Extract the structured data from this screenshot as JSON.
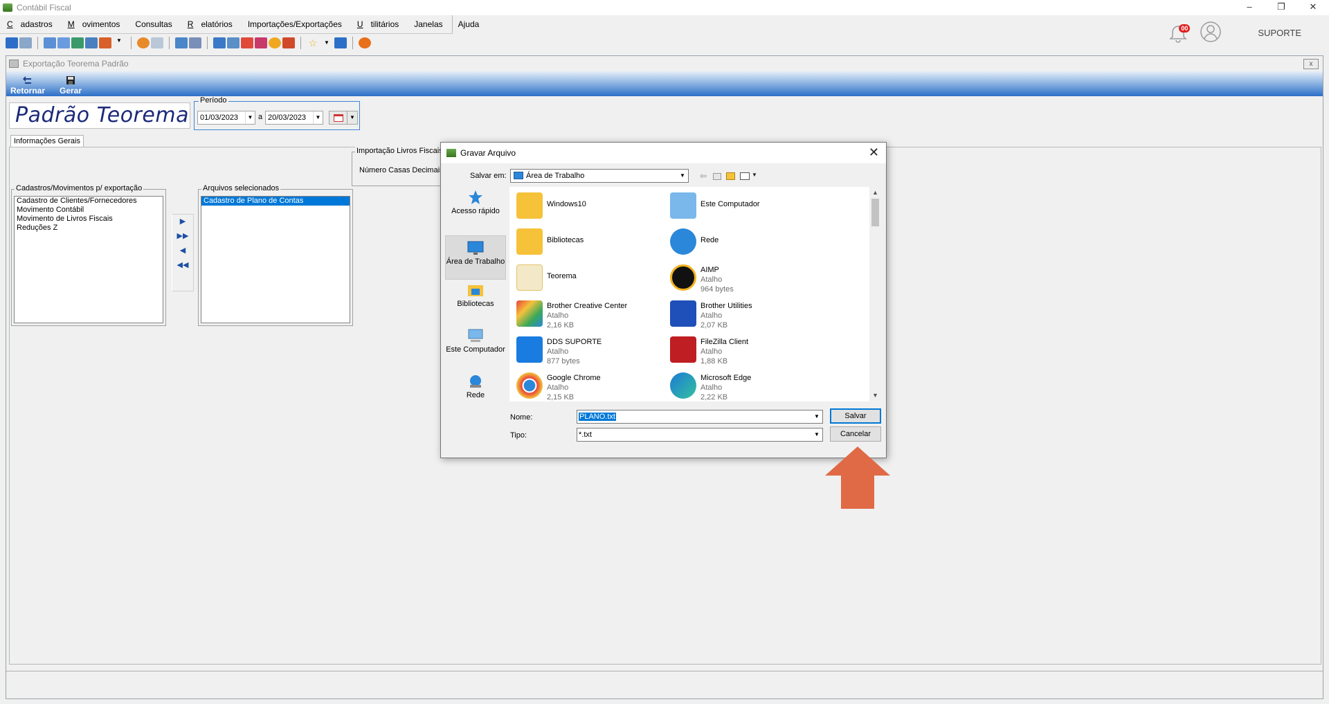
{
  "app": {
    "title": "Contábil Fiscal",
    "window_buttons": [
      "–",
      "❐",
      "✕"
    ],
    "menu": [
      {
        "label": "Cadastros",
        "u": "C",
        "rest": "adastros"
      },
      {
        "label": "Movimentos",
        "u": "M",
        "rest": "ovimentos"
      },
      {
        "label": "Consultas",
        "u": "",
        "rest": "Consultas"
      },
      {
        "label": "Relatórios",
        "u": "R",
        "rest": "elatórios"
      },
      {
        "label": "Importações/Exportações",
        "u": "",
        "rest": "Importações/Exportações"
      },
      {
        "label": "Utilitários",
        "u": "U",
        "rest": "tilitários"
      },
      {
        "label": "Janelas",
        "u": "",
        "rest": "Janelas"
      },
      {
        "label": "Ajuda",
        "u": "",
        "rest": "Ajuda"
      }
    ],
    "notifications_badge": "00",
    "user": "SUPORTE"
  },
  "child_window": {
    "title": "Exportação Teorema Padrão",
    "close_label": "x",
    "toolbar": {
      "back_label": "Retornar",
      "generate_label": "Gerar"
    },
    "brand": "Padrão Teorema",
    "periodo": {
      "label": "Período",
      "from": "01/03/2023",
      "sep": "a",
      "to": "20/03/2023"
    },
    "tab": "Informações Gerais",
    "import_group": {
      "label": "Importação Livros Fiscais",
      "decimals_label": "Número Casas Decimais"
    },
    "available": {
      "label": "Cadastros/Movimentos p/ exportação",
      "items": [
        "Cadastro de Clientes/Fornecedores",
        "Movimento Contábil",
        "Movimento de Livros Fiscais",
        "Reduções Z"
      ]
    },
    "selected": {
      "label": "Arquivos selecionados",
      "items": [
        "Cadastro de Plano de Contas"
      ]
    },
    "move_buttons": [
      "▶",
      "▶▶",
      "◀",
      "◀◀"
    ]
  },
  "dialog": {
    "title": "Gravar Arquivo",
    "save_in_label": "Salvar em:",
    "save_in_value": "Área de Trabalho",
    "places": [
      {
        "label": "Acesso rápido",
        "icon": "star-icon"
      },
      {
        "label": "Área de Trabalho",
        "icon": "desktop-icon"
      },
      {
        "label": "Bibliotecas",
        "icon": "library-icon"
      },
      {
        "label": "Este Computador",
        "icon": "computer-icon"
      },
      {
        "label": "Rede",
        "icon": "network-icon"
      }
    ],
    "files": [
      {
        "name": "Windows10",
        "type": "",
        "size": "",
        "icon": "user-folder-icon"
      },
      {
        "name": "Este Computador",
        "type": "",
        "size": "",
        "icon": "computer-icon"
      },
      {
        "name": "Bibliotecas",
        "type": "",
        "size": "",
        "icon": "library-icon"
      },
      {
        "name": "Rede",
        "type": "",
        "size": "",
        "icon": "network-icon"
      },
      {
        "name": "Teorema",
        "type": "",
        "size": "",
        "icon": "folder-icon"
      },
      {
        "name": "AIMP",
        "type": "Atalho",
        "size": "964 bytes",
        "icon": "aimp-icon"
      },
      {
        "name": "Brother Creative Center",
        "type": "Atalho",
        "size": "2,16 KB",
        "icon": "brother-cc-icon"
      },
      {
        "name": "Brother Utilities",
        "type": "Atalho",
        "size": "2,07 KB",
        "icon": "brother-util-icon"
      },
      {
        "name": "DDS SUPORTE",
        "type": "Atalho",
        "size": "877 bytes",
        "icon": "teamviewer-icon"
      },
      {
        "name": "FileZilla Client",
        "type": "Atalho",
        "size": "1,88 KB",
        "icon": "filezilla-icon"
      },
      {
        "name": "Google Chrome",
        "type": "Atalho",
        "size": "2,15 KB",
        "icon": "chrome-icon"
      },
      {
        "name": "Microsoft Edge",
        "type": "Atalho",
        "size": "2,22 KB",
        "icon": "edge-icon"
      }
    ],
    "name_label": "Nome:",
    "name_value": "PLANO.txt",
    "type_label": "Tipo:",
    "type_value": "*.txt",
    "save_button": "Salvar",
    "cancel_button": "Cancelar"
  },
  "colors": {
    "accent": "#0078d7",
    "annotation_arrow": "#e06a46",
    "brand": "#1c2a7a"
  }
}
